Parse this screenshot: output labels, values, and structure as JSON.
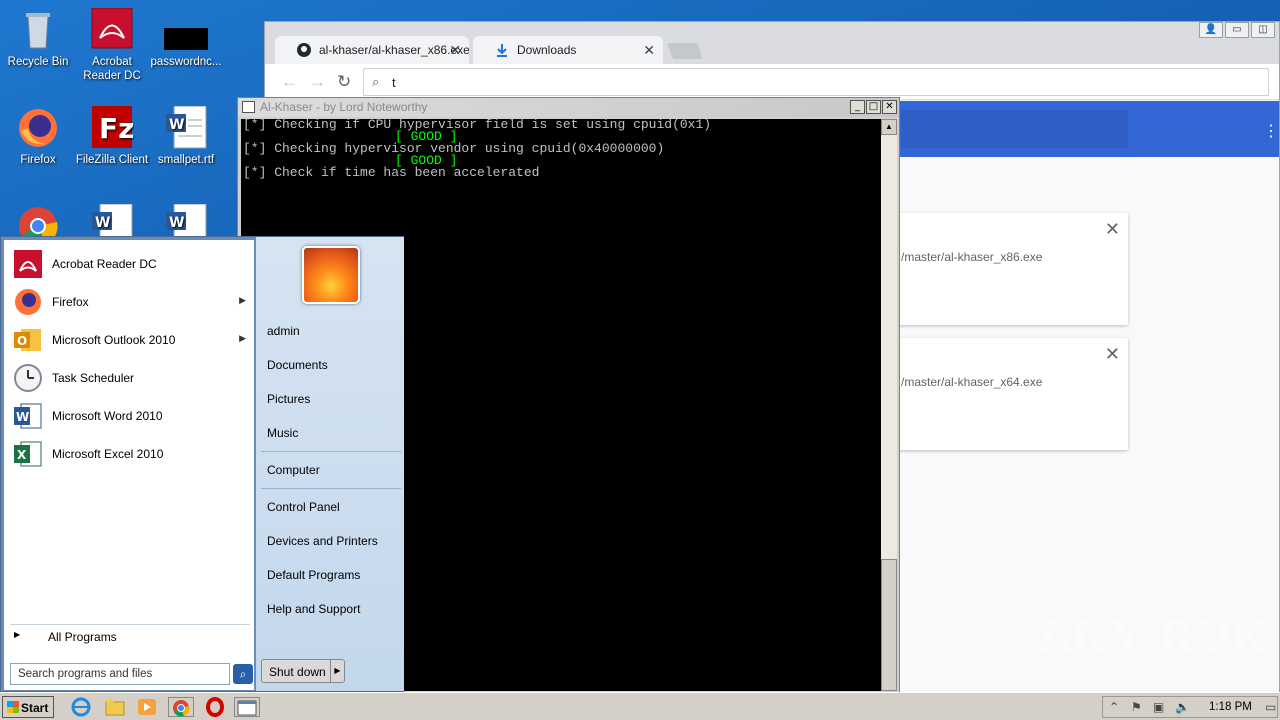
{
  "desktop": {
    "icons": [
      {
        "label": "Recycle Bin",
        "icon": "recycle-bin-icon"
      },
      {
        "label": "Acrobat Reader DC",
        "icon": "acrobat-icon"
      },
      {
        "label": "passwordnc...",
        "icon": "black-file-icon"
      },
      {
        "label": "Firefox",
        "icon": "firefox-icon"
      },
      {
        "label": "FileZilla Client",
        "icon": "filezilla-icon"
      },
      {
        "label": "smallpet.rtf",
        "icon": "word-doc-icon"
      }
    ]
  },
  "chrome": {
    "tabs": [
      {
        "label": "al-khaser/al-khaser_x86.exe",
        "icon": "github-icon"
      },
      {
        "label": "Downloads",
        "icon": "download-icon"
      }
    ],
    "omnibox_text": "t",
    "downloads": [
      {
        "filename": "/master/al-khaser_x86.exe"
      },
      {
        "filename": "/master/al-khaser_x64.exe"
      }
    ]
  },
  "console": {
    "title": "Al-Khaser - by Lord Noteworthy",
    "lines": [
      "[*] Checking if CPU hypervisor field is set using cpuid(0x1)",
      "[ GOOD ]",
      "[*] Checking hypervisor vendor using cpuid(0x40000000)",
      "[ GOOD ]",
      "[*] Check if time has been accelerated"
    ]
  },
  "start_menu": {
    "programs": [
      {
        "label": "Acrobat Reader DC",
        "icon": "acrobat-icon",
        "submenu": false
      },
      {
        "label": "Firefox",
        "icon": "firefox-icon",
        "submenu": true
      },
      {
        "label": "Microsoft Outlook 2010",
        "icon": "outlook-icon",
        "submenu": true
      },
      {
        "label": "Task Scheduler",
        "icon": "clock-icon",
        "submenu": false
      },
      {
        "label": "Microsoft Word 2010",
        "icon": "word-icon",
        "submenu": false
      },
      {
        "label": "Microsoft Excel 2010",
        "icon": "excel-icon",
        "submenu": false
      }
    ],
    "all_programs": "All Programs",
    "search_placeholder": "Search programs and files",
    "right_links": [
      "admin",
      "Documents",
      "Pictures",
      "Music",
      "Computer",
      "Control Panel",
      "Devices and Printers",
      "Default Programs",
      "Help and Support"
    ],
    "shutdown": "Shut down"
  },
  "taskbar": {
    "start_label": "Start",
    "clock": "1:18 PM"
  },
  "watermark": "ANY RUN",
  "colors": {
    "desktop": "#1a64b8",
    "chrome_header": "#3367d6",
    "console_good": "#00ff00"
  }
}
